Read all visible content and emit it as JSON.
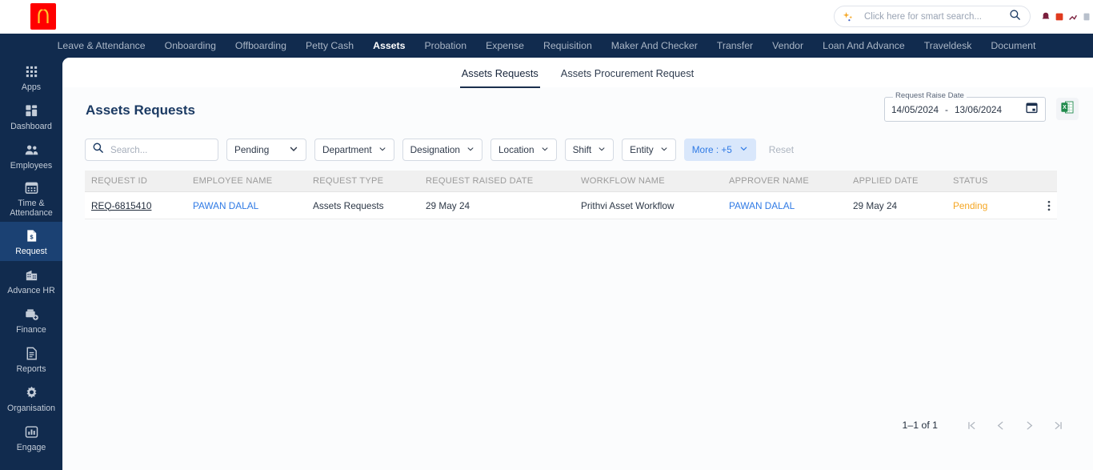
{
  "brand": {
    "logo_alt": "McDonald's",
    "logo_bg": "#ff0000",
    "logo_fg": "#ffc72c"
  },
  "theme": {
    "nav_bg": "#112b4e",
    "accent_blue": "#2f7ae5",
    "status_pending": "#f5a623",
    "sidebar_active_bg": "#1b4173"
  },
  "header": {
    "search": {
      "placeholder": "Click here for smart search...",
      "value": "",
      "icon": "sparkle-icon",
      "action_icon": "search-icon"
    }
  },
  "nav": {
    "items": [
      {
        "label": "Leave & Attendance",
        "active": false
      },
      {
        "label": "Onboarding",
        "active": false
      },
      {
        "label": "Offboarding",
        "active": false
      },
      {
        "label": "Petty Cash",
        "active": false
      },
      {
        "label": "Assets",
        "active": true
      },
      {
        "label": "Probation",
        "active": false
      },
      {
        "label": "Expense",
        "active": false
      },
      {
        "label": "Requisition",
        "active": false
      },
      {
        "label": "Maker And Checker",
        "active": false
      },
      {
        "label": "Transfer",
        "active": false
      },
      {
        "label": "Vendor",
        "active": false
      },
      {
        "label": "Loan And Advance",
        "active": false
      },
      {
        "label": "Traveldesk",
        "active": false
      },
      {
        "label": "Document",
        "active": false
      }
    ]
  },
  "sidebar": {
    "items": [
      {
        "label": "Apps",
        "icon": "grid-apps-icon",
        "active": false
      },
      {
        "label": "Dashboard",
        "icon": "dashboard-icon",
        "active": false
      },
      {
        "label": "Employees",
        "icon": "people-icon",
        "active": false
      },
      {
        "label": "Time & Attendance",
        "icon": "calendar-icon",
        "active": false
      },
      {
        "label": "Request",
        "icon": "document-dollar-icon",
        "active": true
      },
      {
        "label": "Advance HR",
        "icon": "building-icon",
        "active": false
      },
      {
        "label": "Finance",
        "icon": "finance-add-icon",
        "active": false
      },
      {
        "label": "Reports",
        "icon": "report-document-icon",
        "active": false
      },
      {
        "label": "Organisation",
        "icon": "gear-icon",
        "active": false
      },
      {
        "label": "Engage",
        "icon": "bar-chart-icon",
        "active": false
      }
    ]
  },
  "tabs": [
    {
      "label": "Assets Requests",
      "active": true
    },
    {
      "label": "Assets Procurement Request",
      "active": false
    }
  ],
  "page": {
    "title": "Assets Requests"
  },
  "date_range": {
    "legend": "Request Raise Date",
    "start": "14/05/2024",
    "separator": "-",
    "end": "13/06/2024",
    "icon": "calendar-icon"
  },
  "export": {
    "icon": "excel-icon",
    "label": ""
  },
  "filters": {
    "search": {
      "placeholder": "Search...",
      "value": "",
      "icon": "search-icon"
    },
    "dropdowns": [
      {
        "label": "Pending",
        "name": "status-filter",
        "style": "wide"
      },
      {
        "label": "Department",
        "name": "department-filter",
        "style": "normal"
      },
      {
        "label": "Designation",
        "name": "designation-filter",
        "style": "normal"
      },
      {
        "label": "Location",
        "name": "location-filter",
        "style": "normal"
      },
      {
        "label": "Shift",
        "name": "shift-filter",
        "style": "normal"
      },
      {
        "label": "Entity",
        "name": "entity-filter",
        "style": "normal"
      },
      {
        "label": "More : +5",
        "name": "more-filters",
        "style": "more"
      }
    ],
    "reset_label": "Reset"
  },
  "table": {
    "columns": [
      "REQUEST ID",
      "EMPLOYEE NAME",
      "REQUEST TYPE",
      "REQUEST RAISED DATE",
      "WORKFLOW NAME",
      "APPROVER NAME",
      "APPLIED DATE",
      "STATUS"
    ],
    "rows": [
      {
        "request_id": "REQ-6815410",
        "employee_name": "PAWAN DALAL",
        "request_type": "Assets Requests",
        "request_raised_date": "29 May 24",
        "workflow_name": "Prithvi Asset Workflow",
        "approver_name": "PAWAN DALAL",
        "applied_date": "29 May 24",
        "status": "Pending",
        "menu_icon": "kebab-menu-icon"
      }
    ]
  },
  "pagination": {
    "count_label": "1–1 of 1",
    "first_icon": "first-page-icon",
    "prev_icon": "prev-page-icon",
    "next_icon": "next-page-icon",
    "last_icon": "last-page-icon"
  }
}
